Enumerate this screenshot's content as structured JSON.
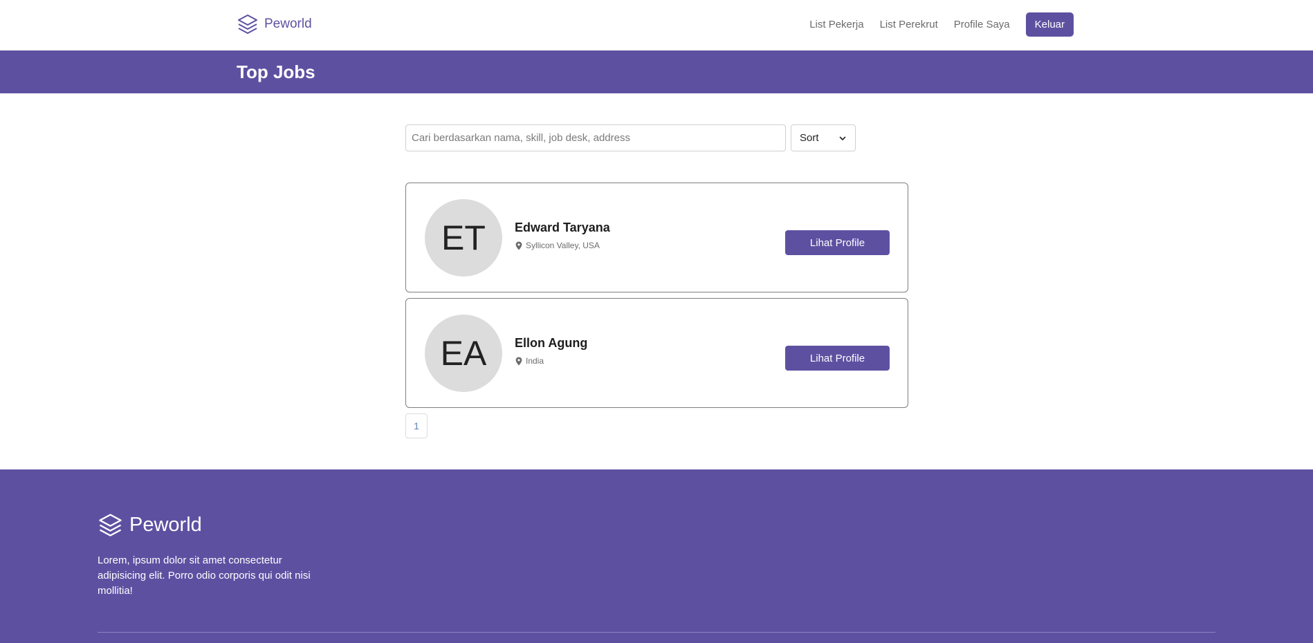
{
  "nav": {
    "brand": "Peworld",
    "links": [
      "List Pekerja",
      "List Perekrut",
      "Profile Saya"
    ],
    "logout": "Keluar"
  },
  "hero": {
    "title": "Top Jobs"
  },
  "search": {
    "placeholder": "Cari berdasarkan nama, skill, job desk, address",
    "value": "",
    "sort_label": "Sort"
  },
  "workers": [
    {
      "initials": "ET",
      "name": "Edward Taryana",
      "location": "Syllicon Valley, USA",
      "button": "Lihat Profile"
    },
    {
      "initials": "EA",
      "name": "Ellon Agung",
      "location": "India",
      "button": "Lihat Profile"
    }
  ],
  "pagination": {
    "current": "1"
  },
  "footer": {
    "brand": "Peworld",
    "description": "Lorem, ipsum dolor sit amet consectetur adipisicing elit. Porro odio corporis qui odit nisi mollitia!"
  },
  "colors": {
    "primary": "#5e50a1",
    "avatar_bg": "#dcdcdc"
  }
}
